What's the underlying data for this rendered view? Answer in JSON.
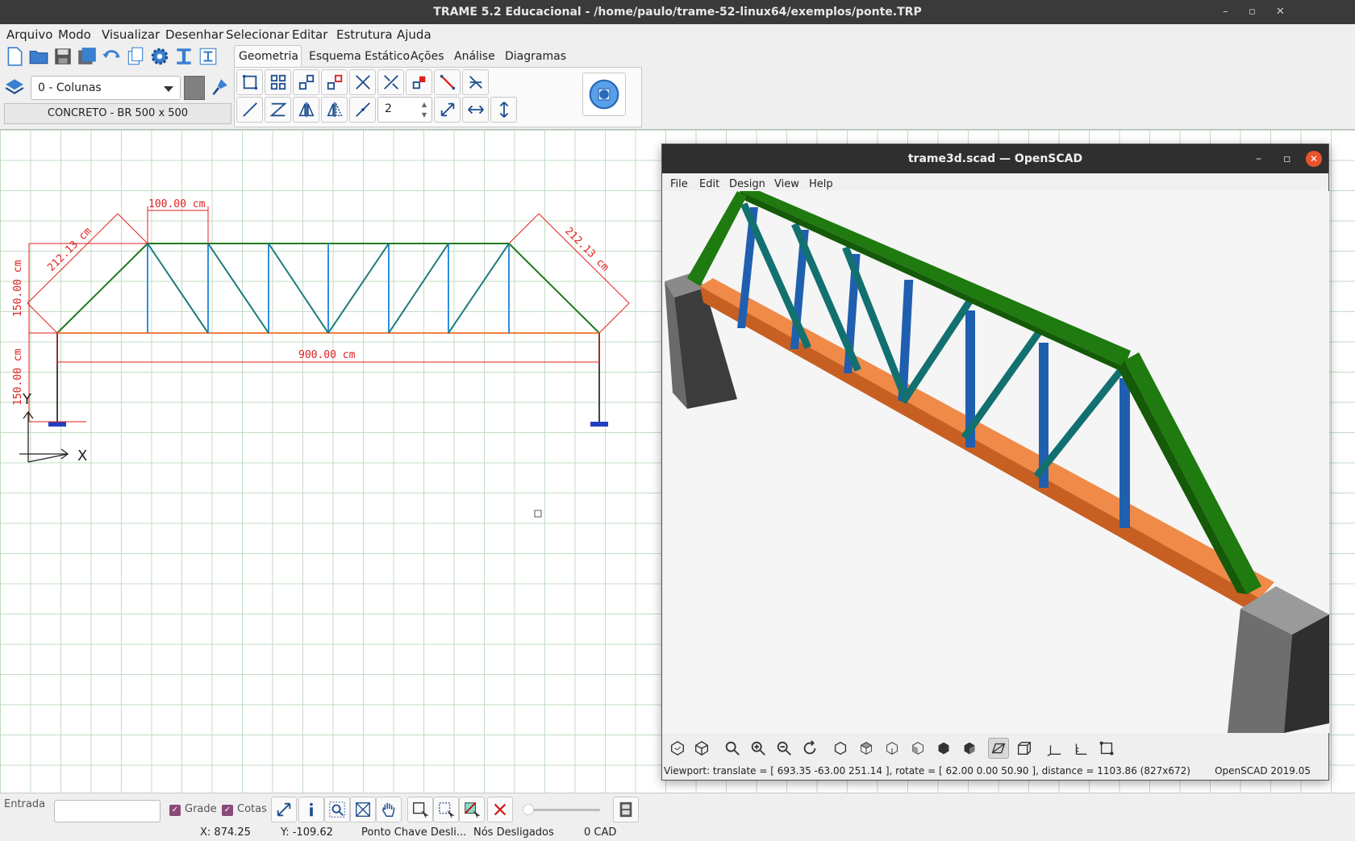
{
  "window": {
    "title": "TRAME 5.2  Educacional  -  /home/paulo/trame-52-linux64/exemplos/ponte.TRP",
    "controls": [
      "–",
      "▫",
      "✕"
    ]
  },
  "menu": [
    "Arquivo",
    "Modo",
    "Visualizar",
    "Desenhar",
    "Selecionar",
    "Editar",
    "Estrutura",
    "Ajuda"
  ],
  "tabs": [
    "Geometria",
    "Esquema Estático",
    "Ações",
    "Análise",
    "Diagramas"
  ],
  "active_tab": "Geometria",
  "layer_select": {
    "value": "0 - Colunas"
  },
  "section_label": "CONCRETO - BR 500 x 500",
  "subdivisions_value": "2",
  "drawing": {
    "dim_top": "100.00 cm",
    "dim_left_diag": "212.13 cm",
    "dim_right_diag": "212.13 cm",
    "dim_height_truss": "150.00 cm",
    "dim_height_support": "150.00 cm",
    "dim_span": "900.00 cm",
    "axis_x": "X",
    "axis_y": "Y",
    "colors": {
      "top_chord": "#1f7a1f",
      "bottom_chord": "#f08040",
      "diagonals": "#1a7a7a",
      "verticals": "#2f8fdf",
      "dimensions": "#e02020",
      "supports": "#2040c0"
    }
  },
  "openscad": {
    "title": "trame3d.scad — OpenSCAD",
    "menu": [
      "File",
      "Edit",
      "Design",
      "View",
      "Help"
    ],
    "status": "Viewport: translate = [ 693.35 -63.00 251.14 ], rotate = [ 62.00 0.00 50.90 ], distance = 1103.86 (827x672)",
    "version": "OpenSCAD 2019.05",
    "colors": {
      "top_chord": "#1f7a0f",
      "bottom_chord": "#e8783a",
      "verticals": "#1f5fb0",
      "diagonals": "#137070",
      "pillars": "#5a5a5a"
    }
  },
  "bottom": {
    "entrada_label": "Entrada",
    "grade_label": "Grade",
    "cotas_label": "Cotas"
  },
  "status": {
    "x": "X: 874.25",
    "y": "Y: -109.62",
    "snap": "Ponto Chave Desli...",
    "nodes": "Nós Desligados",
    "mode": "0  CAD"
  }
}
